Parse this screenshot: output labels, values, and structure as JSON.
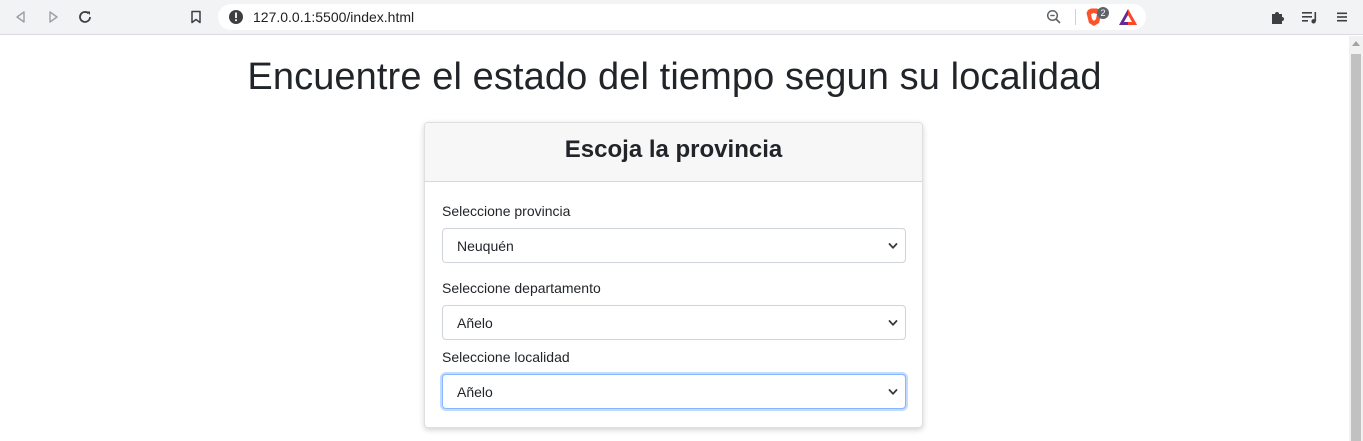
{
  "browser": {
    "url": "127.0.0.1:5500/index.html",
    "brave_badge_count": "2",
    "icons": [
      "back-icon",
      "forward-icon",
      "reload-icon",
      "bookmark-icon",
      "site-info-icon",
      "zoom-icon",
      "brave-shield-icon",
      "bat-rewards-icon",
      "extensions-icon",
      "reading-list-icon",
      "menu-icon"
    ],
    "colors": {
      "chrome_bg": "#f1f3f4",
      "brave_orange": "#fb542b"
    }
  },
  "page": {
    "title": "Encuentre el estado del tiempo segun su localidad",
    "card": {
      "header": "Escoja la provincia",
      "fields": [
        {
          "label": "Seleccione provincia",
          "value": "Neuquén"
        },
        {
          "label": "Seleccione departamento",
          "value": "Añelo"
        },
        {
          "label": "Seleccione localidad",
          "value": "Añelo",
          "focused": true
        }
      ]
    },
    "colors": {
      "text": "#212529",
      "focus_border": "#86b7fe",
      "header_bg": "#f7f7f7"
    }
  }
}
